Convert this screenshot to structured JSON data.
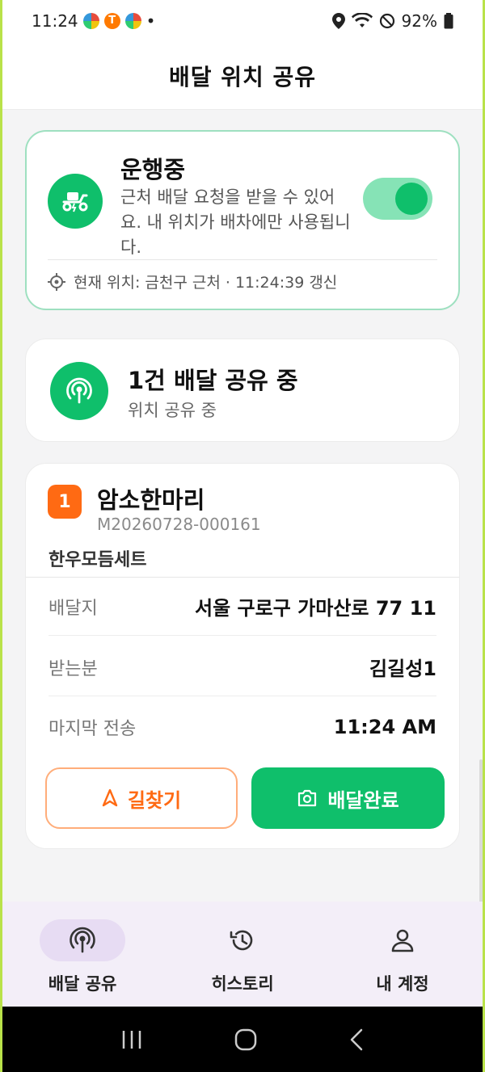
{
  "statusbar": {
    "time": "11:24",
    "dot": "•",
    "battery": "92%"
  },
  "header": {
    "title": "배달 위치 공유"
  },
  "status_card": {
    "title": "운행중",
    "description": "근처 배달 요청을 받을 수 있어요. 내 위치가 배차에만 사용됩니다.",
    "toggle_on": true,
    "location": "현재 위치: 금천구 근처 · 11:24:39 갱신"
  },
  "share_card": {
    "title": "1건 배달 공유 중",
    "subtitle": "위치 공유 중"
  },
  "order": {
    "number": "1",
    "store": "암소한마리",
    "id": "M20260728-000161",
    "product": "한우모듬세트",
    "rows": [
      {
        "label": "배달지",
        "value": "서울 구로구 가마산로 77 11"
      },
      {
        "label": "받는분",
        "value": "김길성1"
      },
      {
        "label": "마지막 전송",
        "value": "11:24 AM"
      }
    ],
    "nav_button": "길찾기",
    "done_button": "배달완료"
  },
  "bottom_nav": {
    "items": [
      {
        "label": "배달 공유",
        "icon": "broadcast-icon"
      },
      {
        "label": "히스토리",
        "icon": "history-icon"
      },
      {
        "label": "내 계정",
        "icon": "person-icon"
      }
    ]
  },
  "colors": {
    "accent": "#0fbf6b",
    "orange": "#ff6a13",
    "nav_bg": "#f3eef8"
  }
}
